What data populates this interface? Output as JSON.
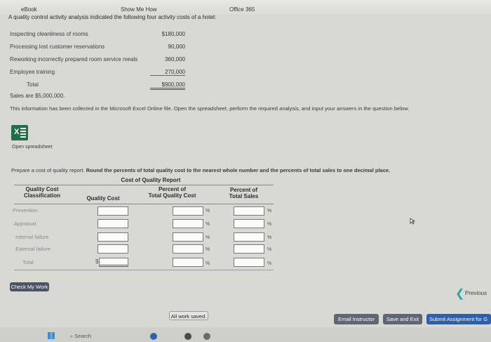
{
  "topbar": {
    "left": "eBook",
    "center": "Show Me How",
    "right": "Office 365"
  },
  "intro": "A quality control activity analysis indicated the following four activity costs of a hotel:",
  "costs": [
    {
      "label": "Inspecting cleanliness of rooms",
      "value": "$180,000"
    },
    {
      "label": "Processing lost customer reservations",
      "value": "90,000"
    },
    {
      "label": "Reworking incorrectly prepared room service meals",
      "value": "360,000"
    },
    {
      "label": "Employee training",
      "value": "270,000"
    }
  ],
  "total": {
    "label": "Total",
    "value": "$900,000"
  },
  "sales_text": "Sales are $5,000,000.",
  "info_text": "This information has been collected in the Microsoft Excel Online file. Open the spreadsheet, perform the required analysis, and input your answers in the question below.",
  "excel": {
    "icon": "excel-icon",
    "label": "Open spreadsheet"
  },
  "instruction_prefix": "Prepare a cost of quality report.",
  "instruction_bold": "Round the percents of total quality cost to the nearest whole number and the percents of total sales to one decimal place.",
  "report": {
    "title": "Cost of Quality Report",
    "headers": {
      "classification": [
        "Quality Cost",
        "Classification"
      ],
      "cost": "Quality Cost",
      "pct_total": [
        "Percent of",
        "Total Quality Cost"
      ],
      "pct_sales": [
        "Percent of",
        "Total Sales"
      ]
    },
    "rows": [
      "Prevention",
      "Appraisal",
      "Internal failure",
      "External failure",
      "Total"
    ],
    "dollar_sign": "$",
    "pct_sign": "%"
  },
  "buttons": {
    "check": "Check My Work",
    "previous": "Previous",
    "email": "Email Instructor",
    "save_exit": "Save and Exit",
    "submit": "Submit Assignment for G"
  },
  "status": "All work saved.",
  "taskbar": {
    "search": "Search"
  }
}
